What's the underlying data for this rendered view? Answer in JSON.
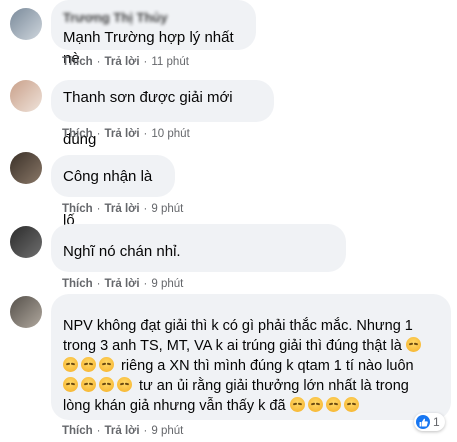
{
  "comments": [
    {
      "author": "Trương Thị Thủy",
      "text": "Mạnh Trường hợp lý nhất nè",
      "like_label": "Thích",
      "reply_label": "Trả lời",
      "time": "11 phút",
      "avatar_colors": [
        "#7a8a9a",
        "#cfd6dd"
      ]
    },
    {
      "author": "",
      "text": "Thanh sơn được giải mới đúng",
      "like_label": "Thích",
      "reply_label": "Trả lời",
      "time": "10 phút",
      "avatar_colors": [
        "#c9a08a",
        "#efe3da"
      ]
    },
    {
      "author": "",
      "text": "Công nhận là lố",
      "like_label": "Thích",
      "reply_label": "Trả lời",
      "time": "9 phút",
      "avatar_colors": [
        "#3a3028",
        "#8a7868"
      ]
    },
    {
      "author": "",
      "text": "Nghĩ nó chán nhỉ.",
      "like_label": "Thích",
      "reply_label": "Trả lời",
      "time": "9 phút",
      "avatar_colors": [
        "#2b2b2b",
        "#6f6f6f"
      ]
    },
    {
      "author": "",
      "text_lines": [
        "NPV không đạt giải thì k có gì phải thắc mắc. Nhưng 1",
        "trong 3 anh TS, MT, VA k ai trúng giải thì đúng thật là",
        "riêng a XN thì mình đúng k qtam 1 tí nào luôn",
        "tư an ủi rằng giải thưởng lớn nhất là trong",
        "lòng khán giả nhưng vẫn thấy k đã"
      ],
      "like_label": "Thích",
      "reply_label": "Trả lời",
      "time": "9 phút",
      "reaction_count": "1",
      "avatar_colors": [
        "#55504a",
        "#b0a89e"
      ]
    }
  ],
  "icons": {
    "emoji": "pensive-face-icon",
    "reaction": "like-icon"
  },
  "colors": {
    "bubble": "#f0f2f5",
    "meta_text": "#65676b",
    "like_blue": "#1877f2"
  }
}
